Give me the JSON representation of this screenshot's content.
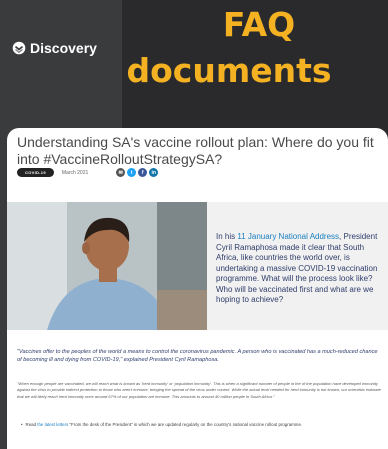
{
  "brand": {
    "name": "Discovery"
  },
  "headline": {
    "line1": "FAQ",
    "line2": "documents"
  },
  "document": {
    "title": "Understanding SA's vaccine rollout plan: Where do you fit into #VaccineRolloutStrategySA?",
    "tag": "COVID-19",
    "date": "March 2021",
    "share_icons": [
      "email-icon",
      "twitter-icon",
      "facebook-icon",
      "linkedin-icon"
    ],
    "intro_prefix": "In his ",
    "intro_link": "11 January National Address",
    "intro_rest": ", President Cyril Ramaphosa made it clear that South Africa, like countries the world over, is undertaking a massive COVID-19 vaccination programme. What will the process look like? Who will be vaccinated first and what are we hoping to achieve?",
    "quote": "\"Vaccines offer to the peoples of the world a means to control the coronavirus pandemic. A person who is vaccinated has a much-reduced chance of becoming ill and dying from COVID-19,\" explained President Cyril Ramaphosa.",
    "paragraph": "\"When enough people are vaccinated, we will reach what is known as 'herd immunity' or 'population immunity'. This is when a significant number of people in the of the population have developed immunity against the virus to provide indirect protection to those who aren't immune, bringing the spread of the virus under control. While the actual level needed for herd immunity is not known, our scientists estimate that we will likely reach herd immunity once around 67% of our population are immune. This amounts to around 40 million people in South Africa.\"",
    "bullet_prefix": "Read ",
    "bullet_link": "the latest letters",
    "bullet_rest": " \"From the desk of the President\" in which we are updated regularly on the country's national vaccine rollout programme."
  },
  "colors": {
    "headline": "#f4b223",
    "email": "#555555",
    "twitter": "#1da1f2",
    "facebook": "#3b5998",
    "linkedin": "#0e76a8"
  }
}
